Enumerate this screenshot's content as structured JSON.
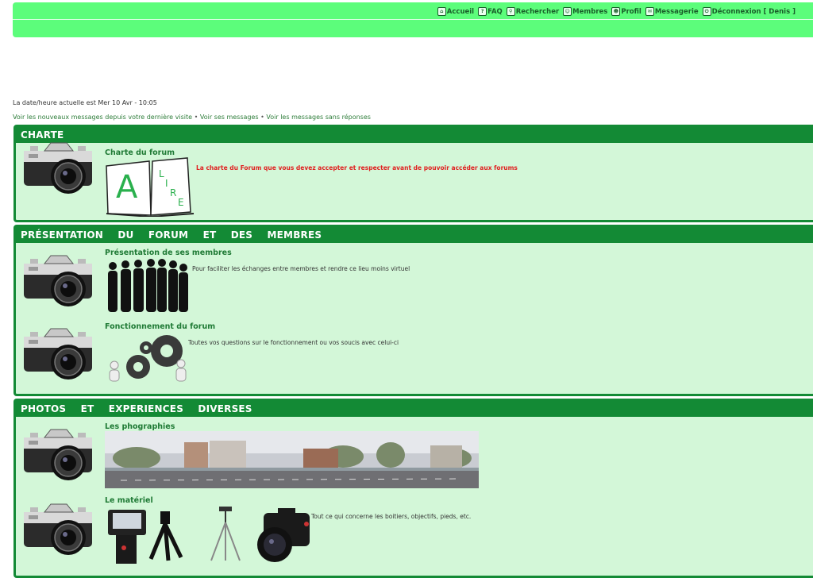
{
  "nav": {
    "items": [
      {
        "label": "Accueil",
        "icon": "home-icon"
      },
      {
        "label": "FAQ",
        "icon": "faq-icon"
      },
      {
        "label": "Rechercher",
        "icon": "search-icon"
      },
      {
        "label": "Membres",
        "icon": "members-icon"
      },
      {
        "label": "Profil",
        "icon": "profile-icon"
      },
      {
        "label": "Messagerie",
        "icon": "mail-icon"
      },
      {
        "label": "Déconnexion [ Denis ]",
        "icon": "logout-icon"
      }
    ]
  },
  "datetime": "La date/heure actuelle est Mer 10 Avr - 10:05",
  "quicklinks": {
    "new": "Voir les nouveaux messages depuis votre dernière visite",
    "sep1": " • ",
    "mine": "Voir ses messages",
    "sep2": " • ",
    "unanswered": "Voir les messages sans réponses"
  },
  "sections": [
    {
      "title": "CHARTE",
      "forums": [
        {
          "title": "Charte du forum",
          "desc": "La charte du Forum que vous devez accepter et respecter avant de pouvoir accéder aux forums",
          "image": "book-a-lire-image",
          "image_text": [
            "A",
            "L",
            "I",
            "R",
            "E"
          ]
        }
      ]
    },
    {
      "title": "PRÉSENTATION DU FORUM ET DES MEMBRES",
      "forums": [
        {
          "title": "Présentation de ses membres",
          "desc": "Pour faciliter les échanges entre membres et rendre ce lieu moins virtuel",
          "image": "silhouettes-image"
        },
        {
          "title": "Fonctionnement du forum",
          "desc": "Toutes vos questions sur le fonctionnement ou vos soucis avec celui-ci",
          "image": "gears-image"
        }
      ]
    },
    {
      "title": "PHOTOS ET EXPERIENCES DIVERSES",
      "forums": [
        {
          "title": "Les phographies",
          "desc": "",
          "image": "street-panorama-image"
        },
        {
          "title": "Le matériel",
          "desc": "Tout ce qui concerne les boitiers, objectifs, pieds, etc.",
          "image": "equipment-image"
        }
      ]
    }
  ],
  "colors": {
    "nav_bg": "#5cfd7b",
    "section_border": "#138a35",
    "section_bg": "#d3f7d8",
    "forum_title": "#1f7a35",
    "charter_desc": "#e02020"
  }
}
